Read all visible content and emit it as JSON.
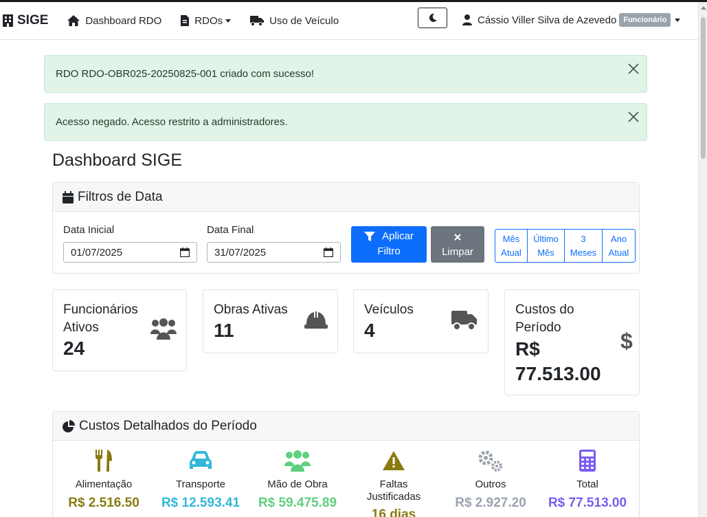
{
  "navbar": {
    "brand": "SIGE",
    "items": [
      {
        "label": "Dashboard RDO"
      },
      {
        "label": "RDOs"
      },
      {
        "label": "Uso de Veículo"
      }
    ],
    "user_name": "Cássio Viller Silva de Azevedo",
    "user_role": "Funcionário"
  },
  "alerts": [
    {
      "text": "RDO RDO-OBR025-20250825-001 criado com sucesso!"
    },
    {
      "text": "Acesso negado. Acesso restrito a administradores."
    }
  ],
  "page_title": "Dashboard SIGE",
  "filters": {
    "title": "Filtros de Data",
    "start_label": "Data Inicial",
    "start_value": "01/07/2025",
    "end_label": "Data Final",
    "end_value": "31/07/2025",
    "apply_line1": "Aplicar",
    "apply_line2": "Filtro",
    "clear_label": "Limpar",
    "presets": [
      {
        "line1": "Mês",
        "line2": "Atual"
      },
      {
        "line1": "Último",
        "line2": "Mês"
      },
      {
        "line1": "3",
        "line2": "Meses"
      },
      {
        "line1": "Ano",
        "line2": "Atual"
      }
    ]
  },
  "stats": {
    "employees": {
      "line1": "Funcionários",
      "line2": "Ativos",
      "value": "24"
    },
    "works": {
      "title": "Obras Ativas",
      "value": "11"
    },
    "vehicles": {
      "title": "Veículos",
      "value": "4"
    },
    "costs": {
      "line1": "Custos do",
      "line2": "Período",
      "value1": "R$",
      "value2": "77.513.00"
    }
  },
  "detailed_costs": {
    "title": "Custos Detalhados do Período",
    "items": [
      {
        "label": "Alimentação",
        "value": "R$ 2.516.50",
        "color": "#8a7a10"
      },
      {
        "label": "Transporte",
        "value": "R$ 12.593.41",
        "color": "#31b8d8"
      },
      {
        "label": "Mão de Obra",
        "value": "R$ 59.475.89",
        "color": "#5fcf7f"
      },
      {
        "label1": "Faltas",
        "label2": "Justificadas",
        "value": "16 dias",
        "color": "#8a7a10"
      },
      {
        "label": "Outros",
        "value": "R$ 2.927.20",
        "color": "#9aa3ad"
      },
      {
        "label": "Total",
        "value": "R$ 77.513.00",
        "color": "#7b5cf0"
      }
    ]
  }
}
